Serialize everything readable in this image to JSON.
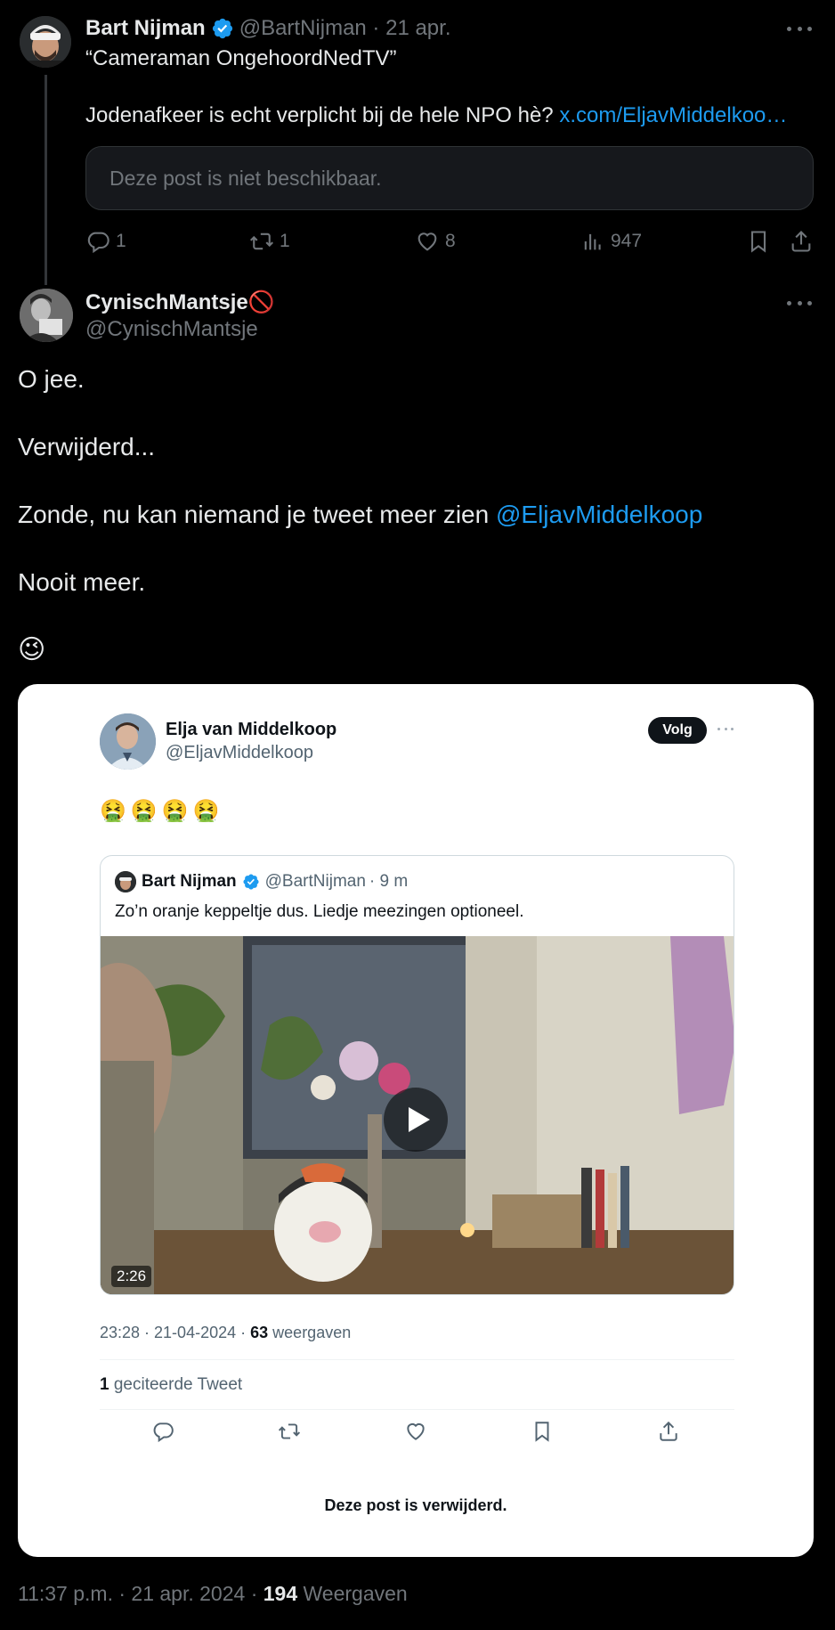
{
  "parent_tweet": {
    "author_name": "Bart Nijman",
    "author_handle": "@BartNijman",
    "date": "21 apr.",
    "text_line1": "“Cameraman OngehoordNedTV”",
    "text_line2": "Jodenafkeer is echt verplicht bij de hele NPO hè?",
    "link_text": "x.com/EljavMiddelkoo…",
    "unavailable_text": "Deze post is niet beschikbaar.",
    "replies": "1",
    "reposts": "1",
    "likes": "8",
    "views": "947"
  },
  "main_tweet": {
    "author_name": "CynischMantsje🚫",
    "author_handle": "@CynischMantsje",
    "para1": "O jee.",
    "para2": "Verwijderd...",
    "para3_text": "Zonde, nu kan niemand je tweet meer zien",
    "para3_mention": "@EljavMiddelkoop",
    "para4": "Nooit meer.",
    "para5_emoji": "😉",
    "timestamp": "11:37 p.m. · 21 apr. 2024 ·",
    "views_count": "194",
    "views_label": "Weergaven"
  },
  "embedded": {
    "author_name": "Elja van Middelkoop",
    "author_handle": "@EljavMiddelkoop",
    "follow_label": "Volg",
    "emojis": [
      "🤮",
      "🤮",
      "🤮",
      "🤮"
    ],
    "quote": {
      "author_name": "Bart Nijman",
      "author_handle": "@BartNijman",
      "time": "· 9 m",
      "text": "Zo’n oranje keppeltje dus. Liedje meezingen optioneel.",
      "video_duration": "2:26"
    },
    "meta_prefix": "23:28 · 21-04-2024 ·",
    "views_count": "63",
    "views_label": "weergaven",
    "quotes_count": "1",
    "quotes_label": "geciteerde Tweet",
    "deleted_text": "Deze post is verwijderd."
  },
  "colors": {
    "background": "#000000",
    "link": "#1d9bf0",
    "muted": "#71767b",
    "verified": "#1d9bf0",
    "forbidden": "#f4212e"
  }
}
